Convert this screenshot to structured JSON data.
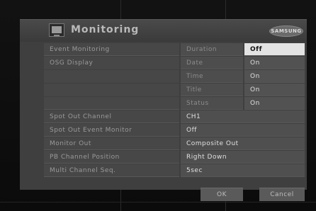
{
  "title": "Monitoring",
  "brand": "SAMSUNG",
  "rows": [
    {
      "label": "Event Monitoring",
      "sub": "Duration",
      "value": "Off"
    },
    {
      "label": "OSG Display",
      "sub": "Date",
      "value": "On"
    },
    {
      "label": "",
      "sub": "Time",
      "value": "On"
    },
    {
      "label": "",
      "sub": "Title",
      "value": "On"
    },
    {
      "label": "",
      "sub": "Status",
      "value": "On"
    },
    {
      "label": "Spot Out Channel",
      "value": "CH1"
    },
    {
      "label": "Spot Out Event Monitor",
      "value": "Off"
    },
    {
      "label": "Monitor Out",
      "value": "Composite Out"
    },
    {
      "label": "PB Channel Position",
      "value": "Right Down"
    },
    {
      "label": "Multi Channel Seq.",
      "value": "5sec"
    }
  ],
  "buttons": {
    "ok": "OK",
    "cancel": "Cancel"
  }
}
